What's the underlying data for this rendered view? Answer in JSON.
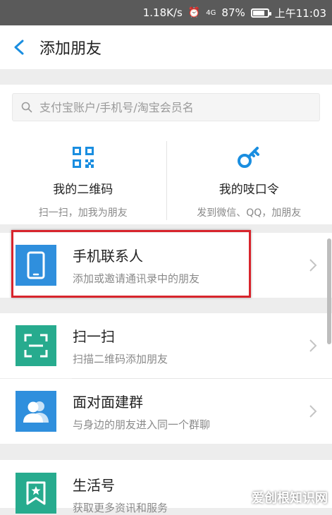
{
  "status_bar": {
    "net_speed": "1.18K/s",
    "signal": "4G",
    "battery": "87%",
    "battery_level": 0.87,
    "time": "上午11:03"
  },
  "nav": {
    "title": "添加朋友"
  },
  "search": {
    "placeholder": "支付宝账户/手机号/淘宝会员名"
  },
  "quick_actions": [
    {
      "title": "我的二维码",
      "subtitle": "扫一扫，加我为朋友"
    },
    {
      "title": "我的吱口令",
      "subtitle": "发到微信、QQ，加朋友"
    }
  ],
  "items": [
    {
      "title": "手机联系人",
      "subtitle": "添加或邀请通讯录中的朋友",
      "color": "#2f8fdd"
    },
    {
      "title": "扫一扫",
      "subtitle": "扫描二维码添加朋友",
      "color": "#27ab8e"
    },
    {
      "title": "面对面建群",
      "subtitle": "与身边的朋友进入同一个群聊",
      "color": "#2f8fdd"
    },
    {
      "title": "生活号",
      "subtitle": "获取更多资讯和服务",
      "color": "#27ab8e"
    }
  ],
  "colors": {
    "accent": "#1a8ee0",
    "highlight_border": "#d8242c"
  },
  "watermark": "爱创根知识网"
}
